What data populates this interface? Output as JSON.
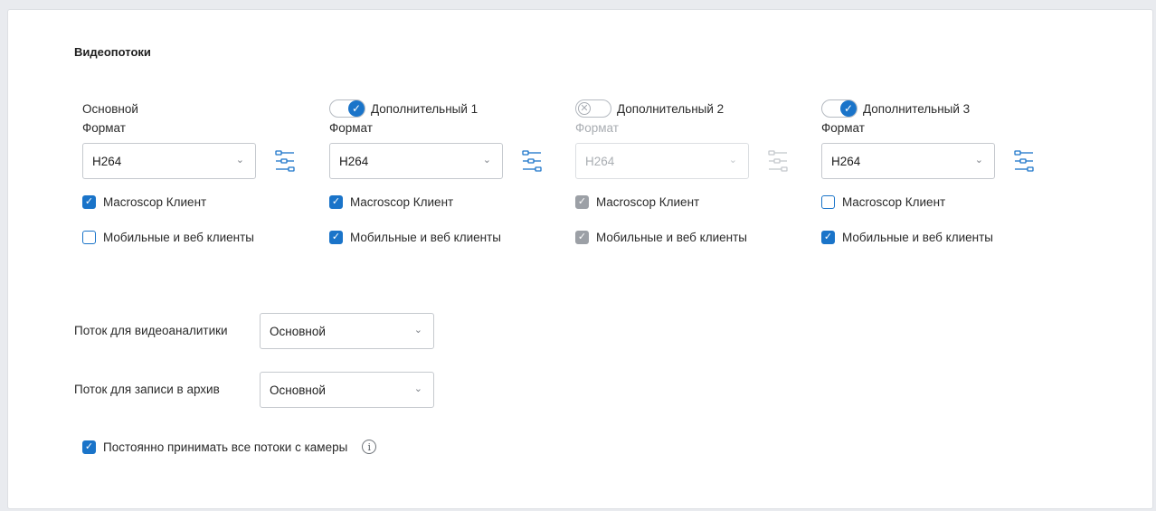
{
  "section_title": "Видеопотоки",
  "streams": [
    {
      "name": "Основной",
      "toggle": "none",
      "format_label": "Формат",
      "format_value": "H264",
      "enabled": true,
      "macroscop_client": {
        "label": "Macroscop Клиент",
        "state": "checked"
      },
      "mobile_web": {
        "label": "Мобильные и веб клиенты",
        "state": "unchecked"
      }
    },
    {
      "name": "Дополнительный 1",
      "toggle": "on",
      "format_label": "Формат",
      "format_value": "H264",
      "enabled": true,
      "macroscop_client": {
        "label": "Macroscop Клиент",
        "state": "checked"
      },
      "mobile_web": {
        "label": "Мобильные и веб клиенты",
        "state": "checked"
      }
    },
    {
      "name": "Дополнительный 2",
      "toggle": "off",
      "format_label": "Формат",
      "format_value": "H264",
      "enabled": false,
      "macroscop_client": {
        "label": "Macroscop Клиент",
        "state": "gray"
      },
      "mobile_web": {
        "label": "Мобильные и веб клиенты",
        "state": "gray"
      }
    },
    {
      "name": "Дополнительный 3",
      "toggle": "on",
      "format_label": "Формат",
      "format_value": "H264",
      "enabled": true,
      "macroscop_client": {
        "label": "Macroscop Клиент",
        "state": "unchecked"
      },
      "mobile_web": {
        "label": "Мобильные и веб клиенты",
        "state": "checked"
      }
    }
  ],
  "analytics_stream": {
    "label": "Поток для видеоаналитики",
    "value": "Основной"
  },
  "archive_stream": {
    "label": "Поток для записи в архив",
    "value": "Основной"
  },
  "always_receive": {
    "label": "Постоянно принимать все потоки с камеры",
    "checked": true
  },
  "icons": {
    "settings": "sliders-settings-icon",
    "dropdown": "chevron-down-icon",
    "info": "info-icon",
    "check": "checkmark-icon",
    "toggle_off": "x-icon"
  },
  "colors": {
    "accent": "#1a74c9",
    "disabled_check": "#9ca0a6",
    "background": "#e9ebef"
  }
}
